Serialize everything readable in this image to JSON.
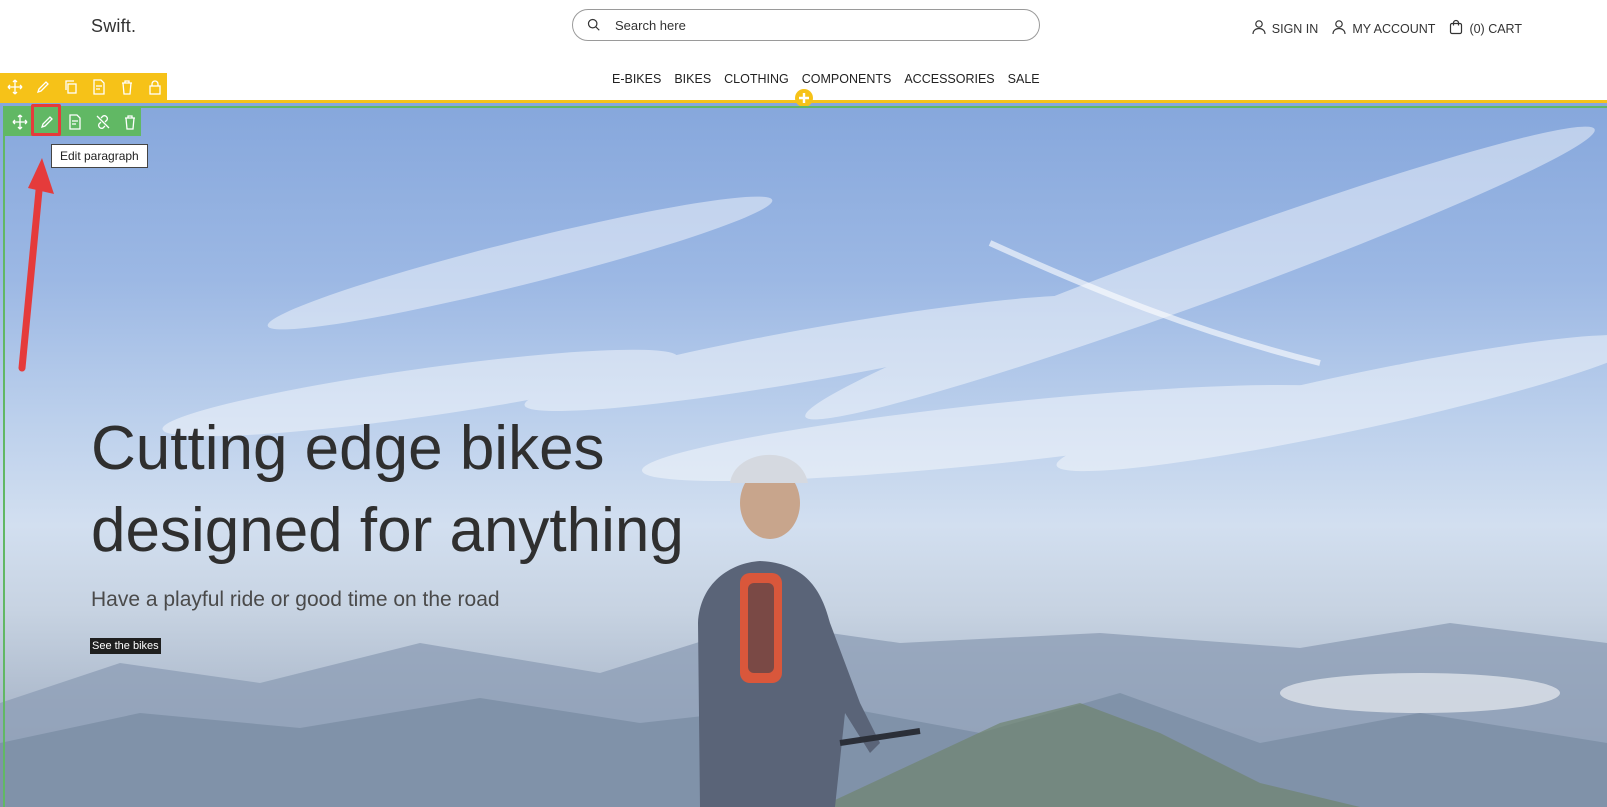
{
  "header": {
    "logo": "Swift.",
    "search_placeholder": "Search here",
    "sign_in": "SIGN IN",
    "my_account": "MY ACCOUNT",
    "cart": "(0) CART"
  },
  "nav": [
    "E-BIKES",
    "BIKES",
    "CLOTHING",
    "COMPONENTS",
    "ACCESSORIES",
    "SALE"
  ],
  "editor": {
    "row_toolbar_icons": [
      "move-icon",
      "pencil-icon",
      "copy-icon",
      "document-settings-icon",
      "trash-icon",
      "lock-icon"
    ],
    "paragraph_toolbar_icons": [
      "move-icon",
      "pencil-icon",
      "document-settings-icon",
      "unlink-icon",
      "trash-icon"
    ],
    "tooltip": "Edit paragraph",
    "toolbar_color_row": "#f6c218",
    "toolbar_color_paragraph": "#61b864",
    "highlight_color": "#e53b3b"
  },
  "hero": {
    "headline_line1": "Cutting edge bikes",
    "headline_line2": "designed for anything",
    "subline": "Have a playful ride or good time on the road",
    "cta": "See the bikes"
  }
}
